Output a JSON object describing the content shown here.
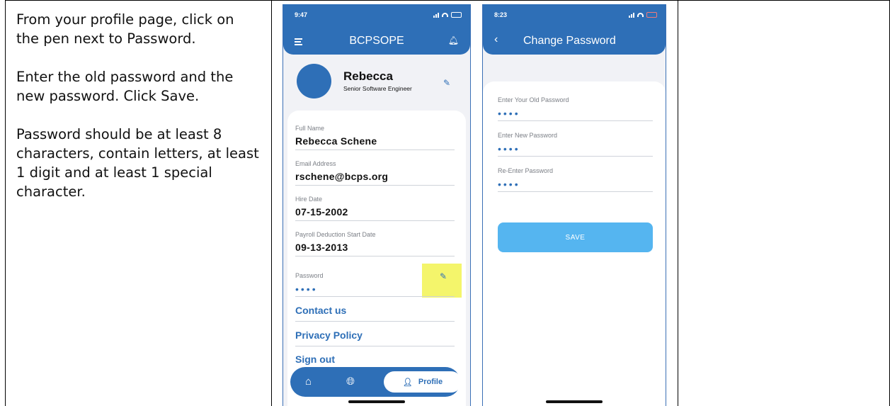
{
  "instructions": {
    "p1": "From your profile page, click on the pen next to Password.",
    "p2": "Enter the old password and the new password.  Click Save.",
    "p3": "Password should be at least 8 characters, contain letters, at least 1 digit and at least 1 special character."
  },
  "screen1": {
    "time": "9:47",
    "title": "BCPSOPE",
    "profile": {
      "name": "Rebecca",
      "role": "Senior Software Engineer"
    },
    "fields": [
      {
        "label": "Full Name",
        "value": "Rebecca Schene"
      },
      {
        "label": "Email Address",
        "value": "rschene@bcps.org"
      },
      {
        "label": "Hire Date",
        "value": "07-15-2002"
      },
      {
        "label": "Payroll Deduction Start Date",
        "value": "09-13-2013"
      },
      {
        "label": "Password",
        "value": "••••"
      }
    ],
    "links": {
      "contact": "Contact us",
      "privacy": "Privacy Policy",
      "signout": "Sign out"
    },
    "nav": {
      "profile_label": "Profile"
    }
  },
  "screen2": {
    "time": "8:23",
    "title": "Change Password",
    "fields": [
      {
        "label": "Enter Your Old Password",
        "value": "••••"
      },
      {
        "label": "Enter New Password",
        "value": "••••"
      },
      {
        "label": "Re-Enter Password",
        "value": "••••"
      }
    ],
    "save_label": "SAVE"
  },
  "colors": {
    "primary": "#2e6fb7",
    "save": "#55b5f0",
    "highlight": "#f4f56b"
  }
}
